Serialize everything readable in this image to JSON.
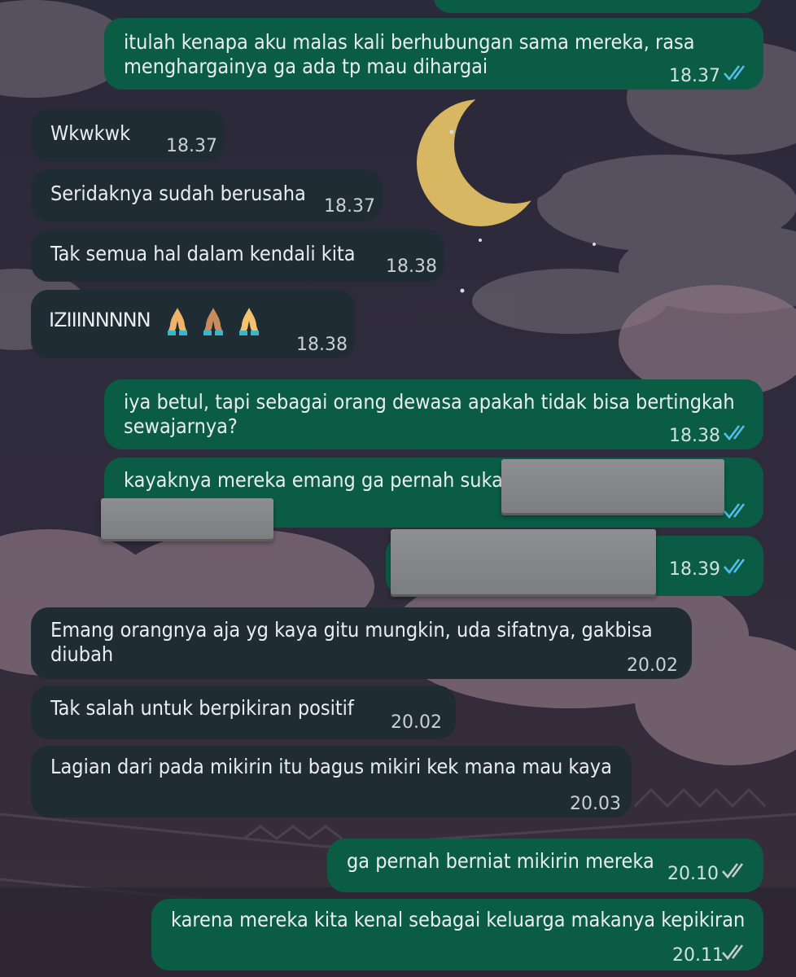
{
  "theme": {
    "incoming_bg": "#1f2c33",
    "outgoing_bg": "#0b5c45",
    "read_tick_color": "#53bdeb",
    "delivered_tick_color": "#c7ccd0",
    "wallpaper": "night sky with crescent moon, clouds and cherry blossom trees"
  },
  "messages": [
    {
      "dir": "out",
      "lines": [
        "itulah kenapa aku malas kali berhubungan sama mereka, rasa",
        "menghargainya ga ada tp mau dihargai"
      ],
      "time": "18.37",
      "status": "read"
    },
    {
      "dir": "in",
      "lines": [
        "Wkwkwk"
      ],
      "time": "18.37"
    },
    {
      "dir": "in",
      "lines": [
        "Seridaknya sudah berusaha"
      ],
      "time": "18.37"
    },
    {
      "dir": "in",
      "lines": [
        "Tak semua hal dalam kendali kita"
      ],
      "time": "18.38"
    },
    {
      "dir": "in",
      "lines": [
        "IZIIINNNNN"
      ],
      "emoji": [
        "folded-hands-icon",
        "folded-hands-icon",
        "folded-hands-icon"
      ],
      "time": "18.38"
    },
    {
      "dir": "out",
      "lines": [
        "iya betul, tapi sebagai orang dewasa apakah tidak bisa bertingkah",
        "sewajarnya?"
      ],
      "time": "18.38",
      "status": "read"
    },
    {
      "dir": "out",
      "lines": [
        "kayaknya mereka emang ga pernah suka"
      ],
      "time": "",
      "status": "read",
      "redacted": true
    },
    {
      "dir": "out",
      "lines": [
        ""
      ],
      "time": "18.39",
      "status": "read",
      "redacted": true
    },
    {
      "dir": "in",
      "lines": [
        "Emang orangnya aja yg kaya gitu mungkin, uda sifatnya, gakbisa",
        "diubah"
      ],
      "time": "20.02"
    },
    {
      "dir": "in",
      "lines": [
        "Tak salah untuk berpikiran positif"
      ],
      "time": "20.02"
    },
    {
      "dir": "in",
      "lines": [
        "Lagian dari pada mikirin itu bagus mikiri kek mana mau kaya"
      ],
      "time": "20.03"
    },
    {
      "dir": "out",
      "lines": [
        "ga pernah berniat mikirin mereka"
      ],
      "time": "20.10",
      "status": "delivered"
    },
    {
      "dir": "out",
      "lines": [
        "karena mereka kita kenal sebagai keluarga makanya kepikiran"
      ],
      "time": "20.11",
      "status": "delivered"
    }
  ]
}
